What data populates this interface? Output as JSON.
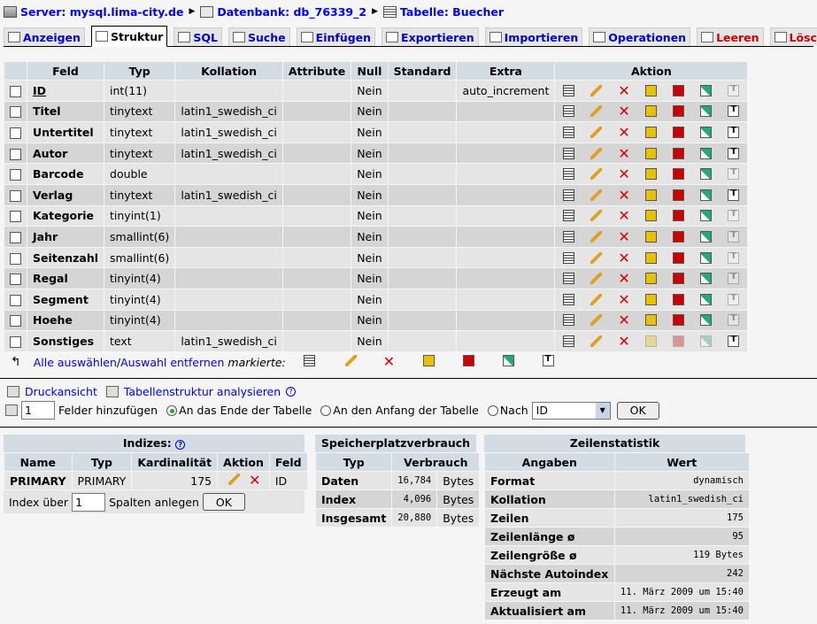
{
  "breadcrumb": {
    "server": "Server: mysql.lima-city.de",
    "database": "Datenbank: db_76339_2",
    "table": "Tabelle: Buecher"
  },
  "tabs": [
    {
      "label": "Anzeigen",
      "icon": "browse-icon"
    },
    {
      "label": "Struktur",
      "icon": "structure-icon",
      "active": true
    },
    {
      "label": "SQL",
      "icon": "sql-icon"
    },
    {
      "label": "Suche",
      "icon": "search-icon"
    },
    {
      "label": "Einfügen",
      "icon": "insert-icon"
    },
    {
      "label": "Exportieren",
      "icon": "export-icon"
    },
    {
      "label": "Importieren",
      "icon": "import-icon"
    },
    {
      "label": "Operationen",
      "icon": "tools-icon"
    },
    {
      "label": "Leeren",
      "icon": "empty-icon"
    },
    {
      "label": "Löschen",
      "icon": "delete-icon"
    }
  ],
  "fields": {
    "headers": [
      "Feld",
      "Typ",
      "Kollation",
      "Attribute",
      "Null",
      "Standard",
      "Extra",
      "Aktion"
    ],
    "rows": [
      {
        "name": "ID",
        "type": "int(11)",
        "collation": "",
        "attribute": "",
        "null": "Nein",
        "default": "",
        "extra": "auto_increment",
        "primary": true
      },
      {
        "name": "Titel",
        "type": "tinytext",
        "collation": "latin1_swedish_ci",
        "attribute": "",
        "null": "Nein",
        "default": "",
        "extra": ""
      },
      {
        "name": "Untertitel",
        "type": "tinytext",
        "collation": "latin1_swedish_ci",
        "attribute": "",
        "null": "Nein",
        "default": "",
        "extra": ""
      },
      {
        "name": "Autor",
        "type": "tinytext",
        "collation": "latin1_swedish_ci",
        "attribute": "",
        "null": "Nein",
        "default": "",
        "extra": ""
      },
      {
        "name": "Barcode",
        "type": "double",
        "collation": "",
        "attribute": "",
        "null": "Nein",
        "default": "",
        "extra": ""
      },
      {
        "name": "Verlag",
        "type": "tinytext",
        "collation": "latin1_swedish_ci",
        "attribute": "",
        "null": "Nein",
        "default": "",
        "extra": ""
      },
      {
        "name": "Kategorie",
        "type": "tinyint(1)",
        "collation": "",
        "attribute": "",
        "null": "Nein",
        "default": "",
        "extra": ""
      },
      {
        "name": "Jahr",
        "type": "smallint(6)",
        "collation": "",
        "attribute": "",
        "null": "Nein",
        "default": "",
        "extra": ""
      },
      {
        "name": "Seitenzahl",
        "type": "smallint(6)",
        "collation": "",
        "attribute": "",
        "null": "Nein",
        "default": "",
        "extra": ""
      },
      {
        "name": "Regal",
        "type": "tinyint(4)",
        "collation": "",
        "attribute": "",
        "null": "Nein",
        "default": "",
        "extra": ""
      },
      {
        "name": "Segment",
        "type": "tinyint(4)",
        "collation": "",
        "attribute": "",
        "null": "Nein",
        "default": "",
        "extra": ""
      },
      {
        "name": "Hoehe",
        "type": "tinyint(4)",
        "collation": "",
        "attribute": "",
        "null": "Nein",
        "default": "",
        "extra": ""
      },
      {
        "name": "Sonstiges",
        "type": "text",
        "collation": "latin1_swedish_ci",
        "attribute": "",
        "null": "Nein",
        "default": "",
        "extra": ""
      }
    ]
  },
  "mark": {
    "select_all": "Alle auswählen",
    "separator": " / ",
    "deselect_all": "Auswahl entfernen",
    "marked": "markierte:"
  },
  "print": {
    "print_view": "Druckansicht",
    "analyze": "Tabellenstruktur analysieren"
  },
  "add_fields": {
    "count": "1",
    "label": "Felder hinzufügen",
    "opt_end": "An das Ende der Tabelle",
    "opt_start": "An den Anfang der Tabelle",
    "opt_after": "Nach",
    "after_field": "ID",
    "ok": "OK"
  },
  "indexes": {
    "title": "Indizes:",
    "headers": [
      "Name",
      "Typ",
      "Kardinalität",
      "Aktion",
      "Feld"
    ],
    "rows": [
      {
        "name": "PRIMARY",
        "type": "PRIMARY",
        "cardinality": "175",
        "field": "ID"
      }
    ],
    "create_label_a": "Index über",
    "create_count": "1",
    "create_label_b": "Spalten anlegen",
    "ok": "OK"
  },
  "space": {
    "title": "Speicherplatzverbrauch",
    "headers": [
      "Typ",
      "Verbrauch"
    ],
    "rows": [
      {
        "type": "Daten",
        "value": "16,784",
        "unit": "Bytes"
      },
      {
        "type": "Index",
        "value": "4,096",
        "unit": "Bytes"
      },
      {
        "type": "Insgesamt",
        "value": "20,880",
        "unit": "Bytes"
      }
    ]
  },
  "rowstats": {
    "title": "Zeilenstatistik",
    "headers": [
      "Angaben",
      "Wert"
    ],
    "rows": [
      {
        "key": "Format",
        "value": "dynamisch"
      },
      {
        "key": "Kollation",
        "value": "latin1_swedish_ci"
      },
      {
        "key": "Zeilen",
        "value": "175"
      },
      {
        "key": "Zeilenlänge ø",
        "value": "95"
      },
      {
        "key": "Zeilengröße ø",
        "value": "119 Bytes"
      },
      {
        "key": "Nächste Autoindex",
        "value": "242"
      },
      {
        "key": "Erzeugt am",
        "value": "11. März 2009 um 15:40"
      },
      {
        "key": "Aktualisiert am",
        "value": "11. März 2009 um 15:40"
      }
    ]
  }
}
